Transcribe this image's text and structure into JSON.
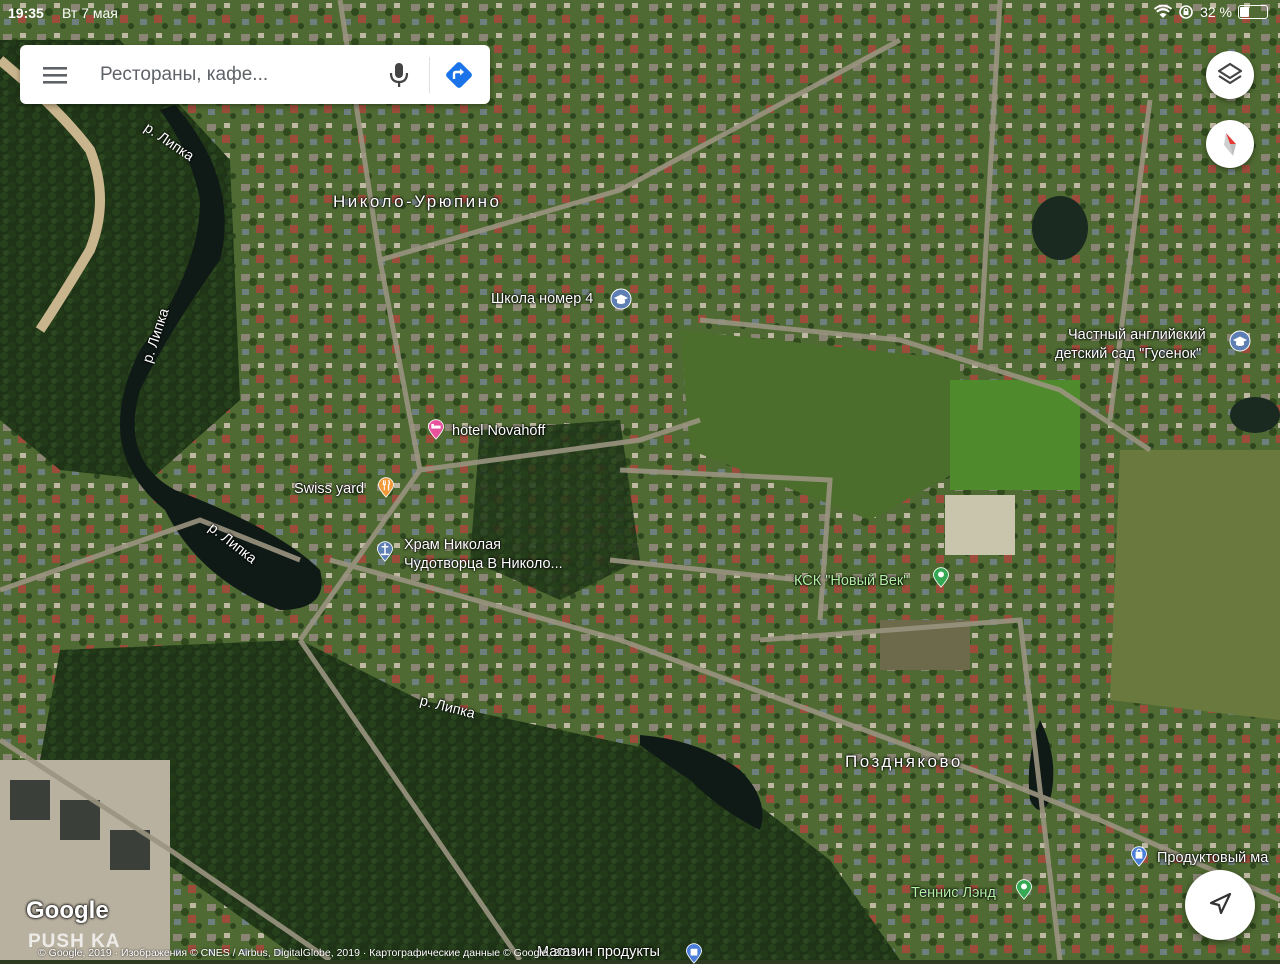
{
  "status_bar": {
    "time": "19:35",
    "date": "Вт 7 мая",
    "battery_text": "32 %",
    "battery_level": 0.32
  },
  "search": {
    "placeholder": "Рестораны, кафе..."
  },
  "map_labels": {
    "village_top": "Николо-Урюпино",
    "village_bottom": "Поздняково",
    "river_1": "р. Липка",
    "river_2": "р. Липка",
    "river_3": "р. Липка",
    "river_4": "р. Липка"
  },
  "pois": {
    "school": "Школа номер 4",
    "kindergarten_line1": "Частный английский",
    "kindergarten_line2": "детский сад \"Гусенок\"",
    "hotel": "hotel Novahoff",
    "restaurant": "Swiss yard",
    "church_line1": "Храм Николая",
    "church_line2": "Чудотворца В Николо...",
    "equestrian": "КСК \"Новый Век\"",
    "grocery": "Продуктовый ма",
    "tennis": "Теннис Лэнд",
    "shop_bottom": "Магазин продукты"
  },
  "footer": {
    "google": "Google",
    "attribution": "© Google, 2019 · Изображения © CNES / Airbus, DigitalGlobe, 2019 · Картографические данные © Google, 2019",
    "watermark": "PUSH KA"
  },
  "colors": {
    "hotel": "#e8519b",
    "restaurant": "#f29a3a",
    "place": "#5d7fb4",
    "park": "#34a853",
    "shop": "#4a7ed9",
    "accent": "#1a73e8",
    "compass_red": "#e53935"
  },
  "icons": [
    "menu-icon",
    "microphone-icon",
    "directions-icon",
    "layers-icon",
    "compass-icon",
    "navigation-arrow-icon"
  ]
}
